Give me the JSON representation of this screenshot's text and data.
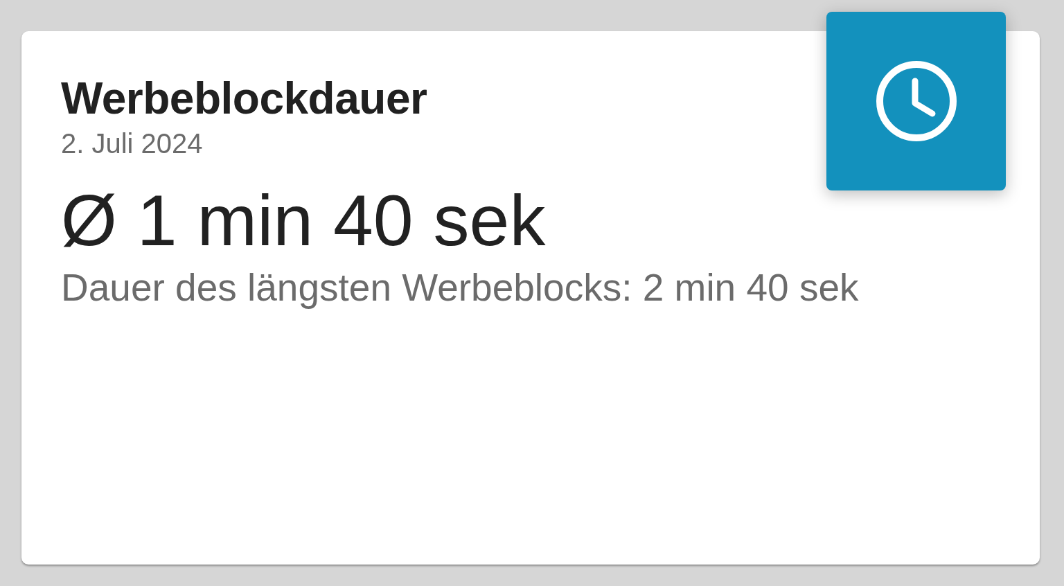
{
  "card": {
    "title": "Werbeblockdauer",
    "date": "2. Juli 2024",
    "value": "Ø 1 min 40 sek",
    "detail": "Dauer des längsten Werbeblocks: 2 min 40 sek"
  }
}
